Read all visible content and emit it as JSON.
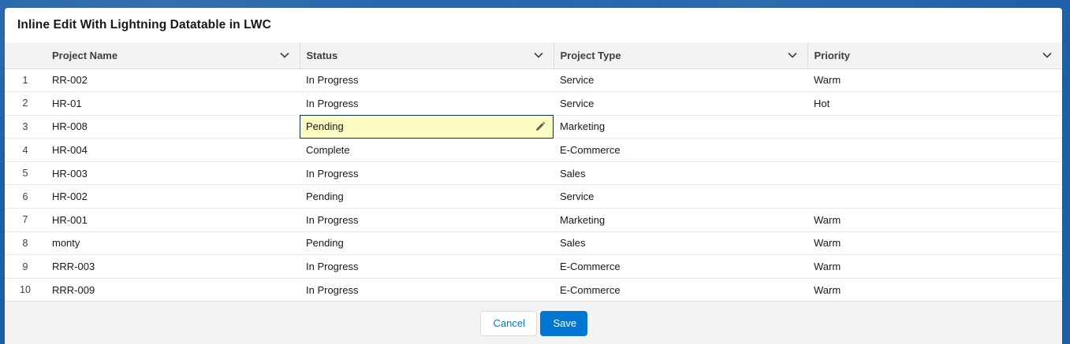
{
  "card": {
    "title": "Inline Edit With Lightning Datatable in LWC"
  },
  "table": {
    "columns": [
      {
        "label": "Project Name"
      },
      {
        "label": "Status"
      },
      {
        "label": "Project Type"
      },
      {
        "label": "Priority"
      }
    ],
    "rows": [
      {
        "num": "1",
        "name": "RR-002",
        "status": "In Progress",
        "type": "Service",
        "priority": "Warm"
      },
      {
        "num": "2",
        "name": "HR-01",
        "status": "In Progress",
        "type": "Service",
        "priority": "Hot"
      },
      {
        "num": "3",
        "name": "HR-008",
        "status": "Pending",
        "type": "Marketing",
        "priority": ""
      },
      {
        "num": "4",
        "name": "HR-004",
        "status": "Complete",
        "type": "E-Commerce",
        "priority": ""
      },
      {
        "num": "5",
        "name": "HR-003",
        "status": "In Progress",
        "type": "Sales",
        "priority": ""
      },
      {
        "num": "6",
        "name": "HR-002",
        "status": "Pending",
        "type": "Service",
        "priority": ""
      },
      {
        "num": "7",
        "name": "HR-001",
        "status": "In Progress",
        "type": "Marketing",
        "priority": "Warm"
      },
      {
        "num": "8",
        "name": "monty",
        "status": "Pending",
        "type": "Sales",
        "priority": "Warm"
      },
      {
        "num": "9",
        "name": "RRR-003",
        "status": "In Progress",
        "type": "E-Commerce",
        "priority": "Warm"
      },
      {
        "num": "10",
        "name": "RRR-009",
        "status": "In Progress",
        "type": "E-Commerce",
        "priority": "Warm"
      }
    ]
  },
  "footer": {
    "cancel_label": "Cancel",
    "save_label": "Save"
  },
  "colors": {
    "brand": "#0176d3",
    "edited_cell": "#fbfcc1",
    "background": "#1b5fa8"
  },
  "icons": {
    "column_menu": "chevron-down-icon",
    "edit": "pencil-icon"
  }
}
